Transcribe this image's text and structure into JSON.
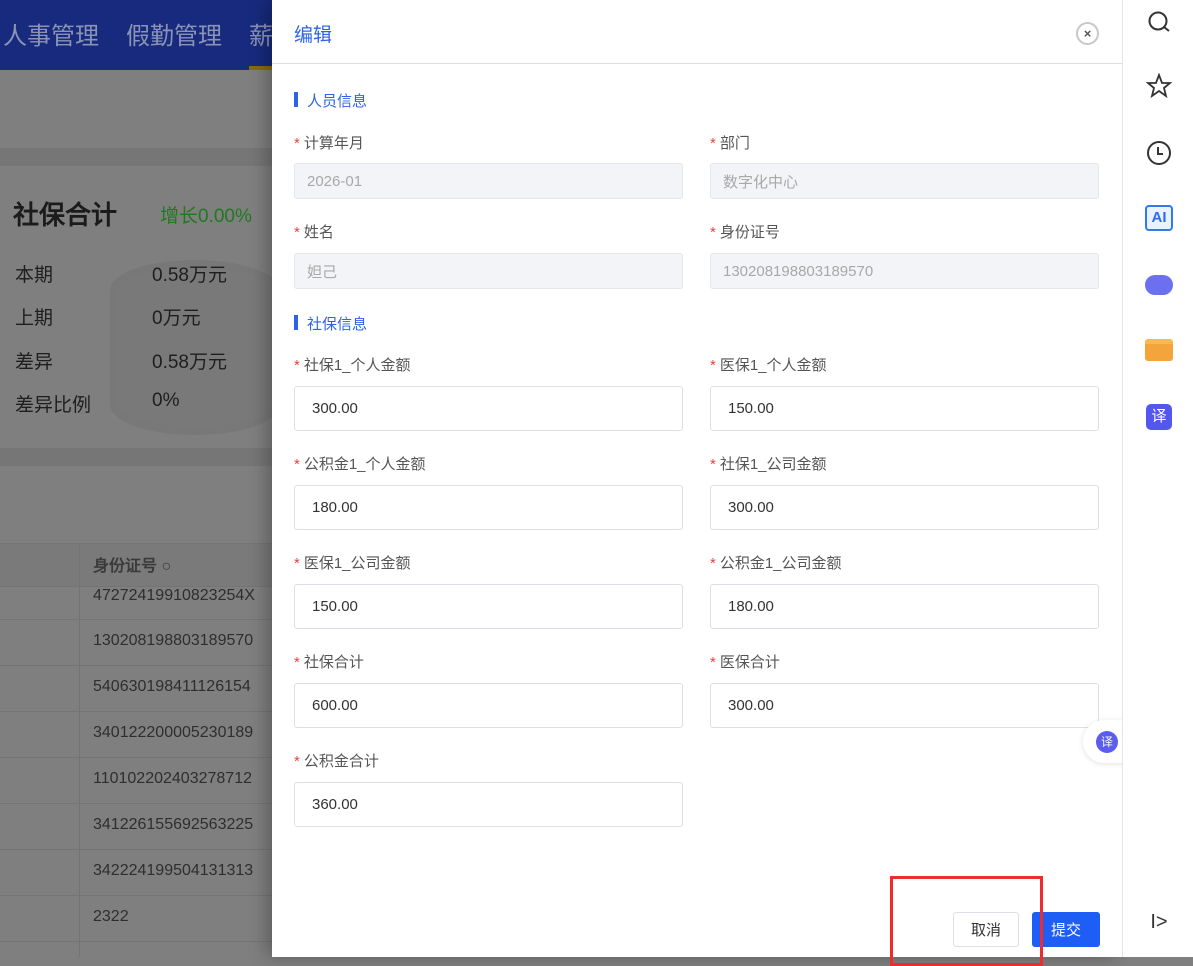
{
  "background": {
    "nav": [
      "人事管理",
      "假勤管理",
      "薪"
    ],
    "card": {
      "title": "社保合计",
      "growth": "增长0.00%",
      "stats": [
        {
          "label": "本期",
          "value": "0.58万元"
        },
        {
          "label": "上期",
          "value": "0万元"
        },
        {
          "label": "差异",
          "value": "0.58万元"
        },
        {
          "label": "差异比例",
          "value": "0%"
        }
      ]
    },
    "table": {
      "header": "身份证号",
      "rows": [
        "47272419910823254X",
        "130208198803189570",
        "540630198411126154",
        "340122200005230189",
        "110102202403278712",
        "341226155692563225",
        "342224199504131313",
        "2322"
      ]
    }
  },
  "drawer": {
    "title": "编辑",
    "close": "×",
    "section1": "人员信息",
    "section2": "社保信息",
    "required": "*",
    "fields": {
      "month": {
        "label": "计算年月",
        "value": "2026-01"
      },
      "dept": {
        "label": "部门",
        "value": "数字化中心"
      },
      "name": {
        "label": "姓名",
        "value": "妲己"
      },
      "idno": {
        "label": "身份证号",
        "value": "130208198803189570"
      },
      "sb_person": {
        "label": "社保1_个人金额",
        "value": "300.00"
      },
      "yb_person": {
        "label": "医保1_个人金额",
        "value": "150.00"
      },
      "gjj_person": {
        "label": "公积金1_个人金额",
        "value": "180.00"
      },
      "sb_company": {
        "label": "社保1_公司金额",
        "value": "300.00"
      },
      "yb_company": {
        "label": "医保1_公司金额",
        "value": "150.00"
      },
      "gjj_company": {
        "label": "公积金1_公司金额",
        "value": "180.00"
      },
      "sb_total": {
        "label": "社保合计",
        "value": "600.00"
      },
      "yb_total": {
        "label": "医保合计",
        "value": "300.00"
      },
      "gjj_total": {
        "label": "公积金合计",
        "value": "360.00"
      }
    },
    "cancel": "取消",
    "submit": "提交"
  },
  "sidebar": {
    "ai": "AI",
    "translate": "译",
    "collapse": "I>"
  }
}
